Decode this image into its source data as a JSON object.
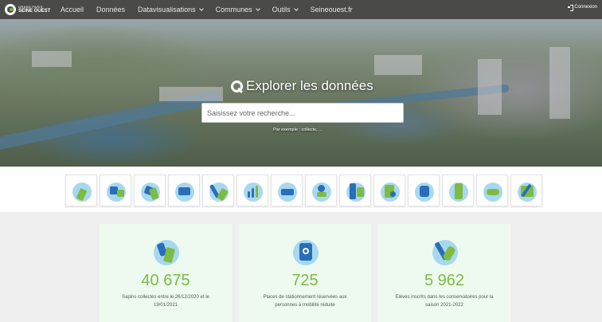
{
  "header": {
    "logo_small": "GRAND PARIS",
    "logo_big": "SEINE OUEST",
    "menu": [
      {
        "label": "Accueil",
        "dropdown": false
      },
      {
        "label": "Données",
        "dropdown": false
      },
      {
        "label": "Datavisualisations",
        "dropdown": true
      },
      {
        "label": "Communes",
        "dropdown": true
      },
      {
        "label": "Outils",
        "dropdown": true
      },
      {
        "label": "Seineouest.fr",
        "dropdown": false
      }
    ],
    "login": "Connexion"
  },
  "hero": {
    "title": "Explorer les données",
    "search_placeholder": "Saisissez votre recherche...",
    "example": "Par exemple : collecte, ..."
  },
  "themes": [
    {
      "icon": "environment-icon"
    },
    {
      "icon": "transport-icon"
    },
    {
      "icon": "waste-icon"
    },
    {
      "icon": "urbanism-icon"
    },
    {
      "icon": "culture-icon"
    },
    {
      "icon": "statistics-icon"
    },
    {
      "icon": "mobility-icon"
    },
    {
      "icon": "territory-icon"
    },
    {
      "icon": "buildings-icon"
    },
    {
      "icon": "documents-icon"
    },
    {
      "icon": "accessibility-icon"
    },
    {
      "icon": "nature-icon"
    },
    {
      "icon": "weather-icon"
    },
    {
      "icon": "map-icon"
    }
  ],
  "kpis": [
    {
      "value": "40 675",
      "label": "Sapins collectés entre le 26/12/2020 et le 19/01/2021",
      "icon": "recycling-icon"
    },
    {
      "value": "725",
      "label": "Places de stationnement réservées aux personnes à mobilité réduite",
      "icon": "wheelchair-icon"
    },
    {
      "value": "5 962",
      "label": "Elèves inscrits dans les conservatoires pour la saison 2021-2022",
      "icon": "music-icon"
    }
  ],
  "colors": {
    "nav": "#4a4a48",
    "accent_green": "#7dbb42",
    "accent_blue": "#2a6eb7",
    "card_bg": "#eefaf0"
  }
}
